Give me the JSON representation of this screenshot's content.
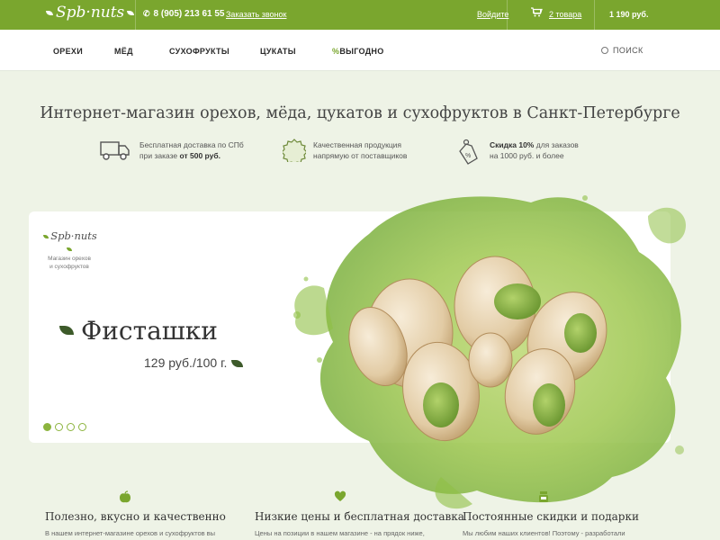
{
  "brand": {
    "logo_text": "Spb·nuts",
    "primary_color": "#7aa62e"
  },
  "topbar": {
    "phone": "8 (905) 213 61 55",
    "phone_icon": "phone-icon",
    "callback_label": "Заказать звонок",
    "login_label": "Войдите",
    "cart_icon": "cart-icon",
    "cart_count": "2 товара",
    "cart_total": "1 190 руб."
  },
  "nav": {
    "items": [
      "ОРЕХИ",
      "МЁД",
      "СУХОФРУКТЫ",
      "ЦУКАТЫ",
      "ВЫГОДНО"
    ],
    "promo_prefix": "%",
    "search_label": "ПОИСК"
  },
  "headline": "Интернет-магазин орехов, мёда, цукатов и сухофруктов в Санкт-Петербурге",
  "features": [
    {
      "icon": "truck-icon",
      "line1": "Бесплатная доставка по СПб",
      "line2_pre": "при заказе ",
      "line2_bold": "от 500 руб."
    },
    {
      "icon": "quality-badge-icon",
      "line1": "Качественная продукция",
      "line2": "напрямую от поставщиков"
    },
    {
      "icon": "discount-tag-icon",
      "line1_bold": "Скидка 10%",
      "line1_rest": " для заказов",
      "line2": "на 1000 руб. и более"
    }
  ],
  "hero": {
    "logo_text": "Spb·nuts",
    "logo_sub1": "Магазин орехов",
    "logo_sub2": "и сухофруктов",
    "title": "Фисташки",
    "price": "129 руб./100 г.",
    "slides_total": 4,
    "active_slide": 1
  },
  "benefits": [
    {
      "icon": "apple-icon",
      "title": "Полезно, вкусно и качественно",
      "text": "В нашем интернет-магазине орехов и сухофруктов вы"
    },
    {
      "icon": "heart-icon",
      "title": "Низкие цены и бесплатная доставка",
      "text": "Цены на позиции в  нашем магазине - на прядок ниже,"
    },
    {
      "icon": "gift-jar-icon",
      "title": "Постоянные скидки и подарки",
      "text": "Мы любим наших клиентов! Поэтому - разработали"
    }
  ]
}
